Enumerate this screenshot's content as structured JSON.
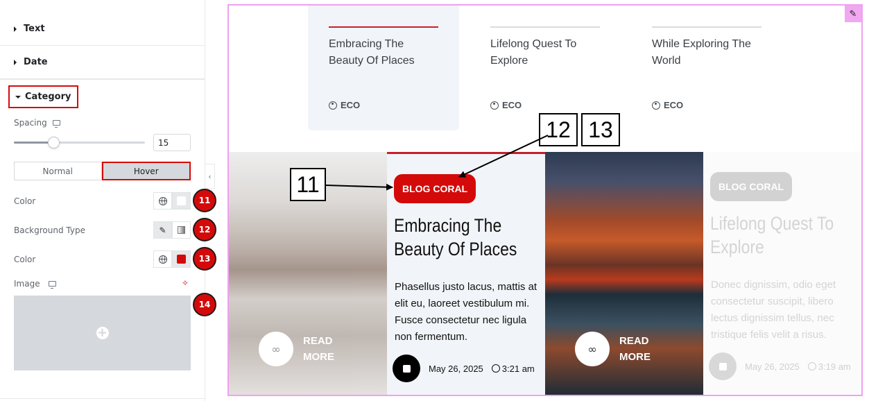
{
  "panel": {
    "sections": [
      {
        "label": "Text"
      },
      {
        "label": "Date"
      }
    ],
    "category": {
      "label": "Category"
    },
    "spacing": {
      "label": "Spacing",
      "value": "15",
      "slider_fraction": 0.3
    },
    "tabs": [
      {
        "label": "Normal"
      },
      {
        "label": "Hover"
      }
    ],
    "active_tab": "Hover",
    "color1": {
      "label": "Color",
      "swatch": "#ffffff"
    },
    "bg_type": {
      "label": "Background Type"
    },
    "color2": {
      "label": "Color",
      "swatch": "#d40a0a"
    },
    "image": {
      "label": "Image"
    },
    "badges": [
      "11",
      "12",
      "13",
      "14"
    ]
  },
  "preview": {
    "nav_cards": [
      {
        "title": "Embracing The Beauty Of Places",
        "meta": "ECO"
      },
      {
        "title": "Lifelong Quest To Explore",
        "meta": "ECO"
      },
      {
        "title": "While Exploring The World",
        "meta": "ECO"
      }
    ],
    "slide_active": {
      "category": "BLOG CORAL",
      "title": "Embracing The Beauty Of Places",
      "text": "Phasellus justo lacus, mattis at elit eu, laoreet vestibulum mi. Fusce consectetur nec ligula non fermentum.",
      "date": "May 26, 2025",
      "time": "3:21 am"
    },
    "slide_faded": {
      "category": "BLOG CORAL",
      "title": "Lifelong Quest To Explore",
      "text": "Donec dignissim, odio eget consectetur suscipit, libero lectus dignissim tellus, nec tristique felis velit a risus.",
      "date": "May 26, 2025",
      "time": "3:19 am"
    },
    "read_more": "READ MORE"
  },
  "annotations": {
    "a11": "11",
    "a12": "12",
    "a13": "13"
  },
  "colors": {
    "accent_red": "#d40a0a",
    "selection_border": "#f0a0f0",
    "active_line": "#c81e2b"
  }
}
